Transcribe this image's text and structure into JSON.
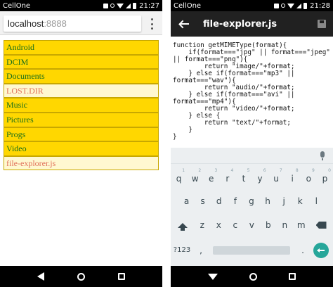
{
  "left_phone": {
    "status": {
      "carrier": "CellOne",
      "time": "21:27"
    },
    "browser": {
      "url_host": "localhost",
      "url_port": ":8888"
    },
    "files": [
      {
        "name": "Android",
        "kind": "dir"
      },
      {
        "name": "DCIM",
        "kind": "dir"
      },
      {
        "name": "Documents",
        "kind": "dir"
      },
      {
        "name": "LOST.DIR",
        "kind": "file"
      },
      {
        "name": "Music",
        "kind": "dir"
      },
      {
        "name": "Pictures",
        "kind": "dir"
      },
      {
        "name": "Progs",
        "kind": "dir"
      },
      {
        "name": "Video",
        "kind": "dir"
      },
      {
        "name": "file-explorer.js",
        "kind": "file"
      }
    ]
  },
  "right_phone": {
    "status": {
      "carrier": "CellOne",
      "time": "21:28"
    },
    "editor": {
      "title": "file-explorer.js",
      "code": "function getMIMEType(format){\n    if(format===\"jpg\" || format===\"jpeg\"\n|| format===\"png\"){\n        return \"image/\"+format;\n    } else if(format===\"mp3\" ||\nformat===\"wav\"){\n        return \"audio/\"+format;\n    } else if(format===\"avi\" ||\nformat===\"mp4\"){\n        return \"video/\"+format;\n    } else {\n        return \"text/\"+format;\n    }\n}"
    },
    "keyboard": {
      "row1": [
        {
          "k": "q",
          "n": "1"
        },
        {
          "k": "w",
          "n": "2"
        },
        {
          "k": "e",
          "n": "3"
        },
        {
          "k": "r",
          "n": "4"
        },
        {
          "k": "t",
          "n": "5"
        },
        {
          "k": "y",
          "n": "6"
        },
        {
          "k": "u",
          "n": "7"
        },
        {
          "k": "i",
          "n": "8"
        },
        {
          "k": "o",
          "n": "9"
        },
        {
          "k": "p",
          "n": "0"
        }
      ],
      "row2": [
        "a",
        "s",
        "d",
        "f",
        "g",
        "h",
        "j",
        "k",
        "l"
      ],
      "row3": [
        "z",
        "x",
        "c",
        "v",
        "b",
        "n",
        "m"
      ],
      "symbols_label": "?123",
      "comma": ",",
      "period": "."
    }
  },
  "colors": {
    "dir_bg": "#ffd700",
    "dir_text": "#1a6e1a",
    "file_bg": "#fff8d0",
    "file_text": "#e0705a",
    "appbar": "#212121",
    "enter_key": "#26a69a"
  },
  "icons": [
    "wifi-icon",
    "signal-icon",
    "battery-icon",
    "overflow-menu-icon",
    "back-arrow-icon",
    "save-icon",
    "mic-icon",
    "shift-icon",
    "backspace-icon",
    "enter-icon",
    "nav-back-icon",
    "nav-home-icon",
    "nav-recents-icon"
  ]
}
